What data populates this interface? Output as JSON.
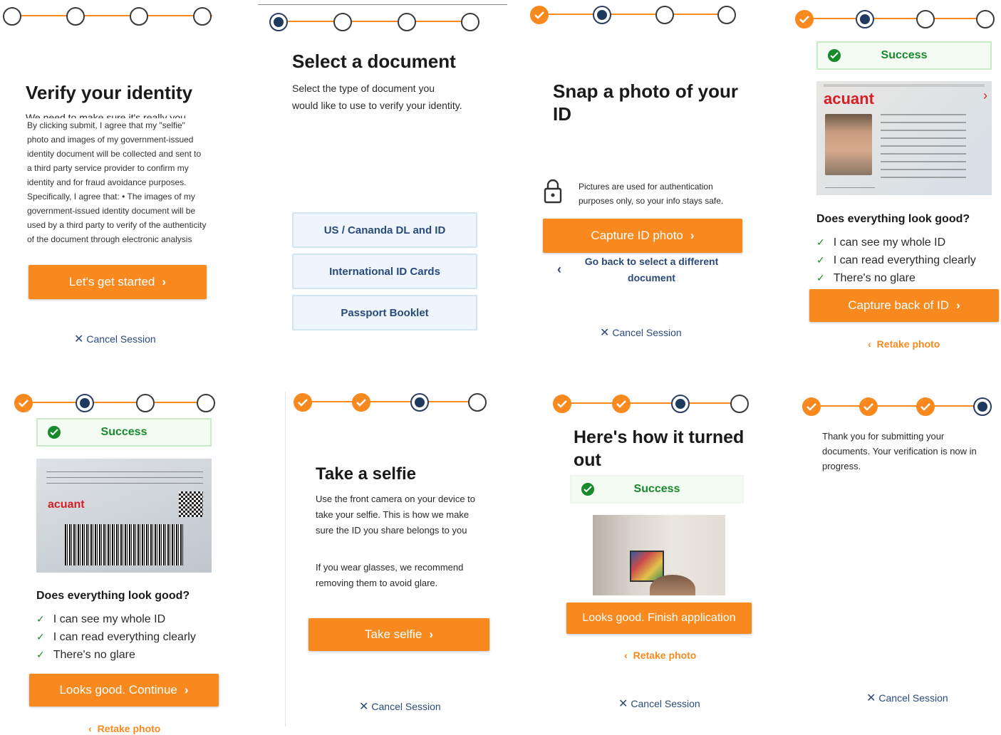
{
  "brand": {
    "accent": "#f7891e",
    "current_step": "#1f3a5f",
    "success": "#168a2c",
    "link": "#2a4a7a"
  },
  "p1": {
    "title": "Verify your identity",
    "partial_line": "We need to make sure it's really you",
    "consent": "By clicking submit, I agree that my \"selfie\" photo and images of my government-issued identity document will be collected and sent to a third party service provider to confirm my identity and for fraud avoidance purposes. Specifically, I agree that: • The images of my government-issued identity document will be used by a third party to verify of the authenticity of the document through electronic analysis",
    "start_label": "Let's get started",
    "cancel_label": "Cancel Session"
  },
  "p2": {
    "title": "Select a document",
    "body": "Select the type of document you would like to use to verify your identity.",
    "options": [
      "US / Cananda DL and ID",
      "International ID Cards",
      "Passport Booklet"
    ]
  },
  "p3": {
    "title": "Snap a photo of your ID",
    "lock_note": "Pictures are used for authentication purposes only, so your info stays safe.",
    "capture_label": "Capture ID photo",
    "back_label": "Go back to select a different document",
    "cancel_label": "Cancel Session"
  },
  "p4": {
    "success_label": "Success",
    "brand_on_id": "acuant",
    "question": "Does everything look good?",
    "checks": [
      "I can see my whole ID",
      "I can read everything clearly",
      "There's no glare"
    ],
    "capture_back_label": "Capture back of ID",
    "retake_label": "Retake photo"
  },
  "p5": {
    "success_label": "Success",
    "brand_on_id": "acuant",
    "question": "Does everything look good?",
    "checks": [
      "I can see my whole ID",
      "I can read everything clearly",
      "There's no glare"
    ],
    "continue_label": "Looks good. Continue",
    "retake_label": "Retake photo"
  },
  "p6": {
    "title": "Take a selfie",
    "body1": "Use the front camera on your device to take your selfie. This is how we make sure the ID you share belongs to you",
    "body2": "If you wear glasses, we recommend removing them to avoid glare.",
    "selfie_label": "Take selfie",
    "cancel_label": "Cancel Session"
  },
  "p7": {
    "title": "Here's how it turned out",
    "success_label": "Success",
    "finish_label": "Looks good. Finish application",
    "retake_label": "Retake photo",
    "cancel_label": "Cancel Session"
  },
  "p8": {
    "message": "Thank you for submitting your documents. Your verification is now in progress.",
    "cancel_label": "Cancel Session"
  }
}
